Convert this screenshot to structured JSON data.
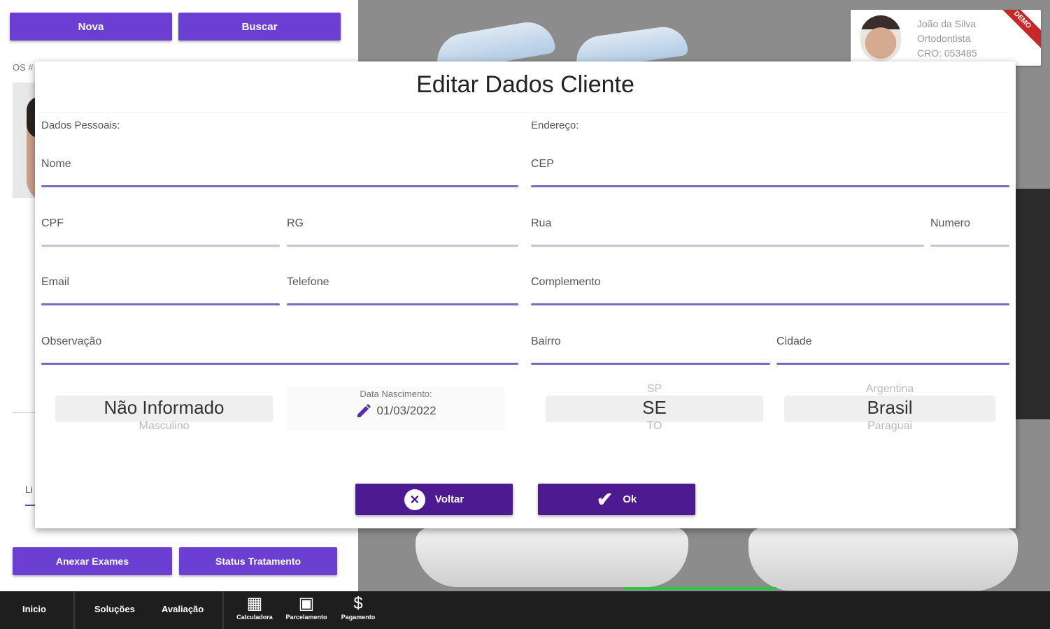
{
  "left_panel": {
    "nova_label": "Nova",
    "buscar_label": "Buscar",
    "os_label": "OS #",
    "li_text": "Li",
    "anexar_label": "Anexar Exames",
    "status_label": "Status Tratamento"
  },
  "profile": {
    "name": "João da Silva",
    "role": "Ortodontista",
    "cro": "CRO: 053485",
    "ribbon": "DEMO"
  },
  "modal": {
    "title": "Editar Dados Cliente",
    "personal_label": "Dados Pessoais:",
    "address_label": "Endereço:",
    "fields": {
      "nome": "Nome",
      "cpf": "CPF",
      "rg": "RG",
      "email": "Email",
      "telefone": "Telefone",
      "observacao": "Observação",
      "cep": "CEP",
      "rua": "Rua",
      "numero": "Numero",
      "complemento": "Complemento",
      "bairro": "Bairro",
      "cidade": "Cidade"
    },
    "gender_picker": {
      "above": "",
      "selected": "Não Informado",
      "below": "Masculino"
    },
    "birth_label": "Data Nascimento:",
    "birth_value": "01/03/2022",
    "state_picker": {
      "above": "SP",
      "selected": "SE",
      "below": "TO"
    },
    "country_picker": {
      "above": "Argentina",
      "selected": "Brasil",
      "below": "Paraguai"
    },
    "back_label": "Voltar",
    "ok_label": "Ok"
  },
  "bottom_nav": {
    "inicio": "Inicio",
    "solucoes": "Soluções",
    "avaliacao": "Avaliação",
    "calculadora": "Calculadora",
    "parcelamento": "Parcelamento",
    "pagamento": "Pagamento",
    "dollar_symbol": "$"
  },
  "colors": {
    "accent": "#6a3fd1",
    "button_dark": "#4d1a91",
    "underline": "#7f67c9"
  }
}
